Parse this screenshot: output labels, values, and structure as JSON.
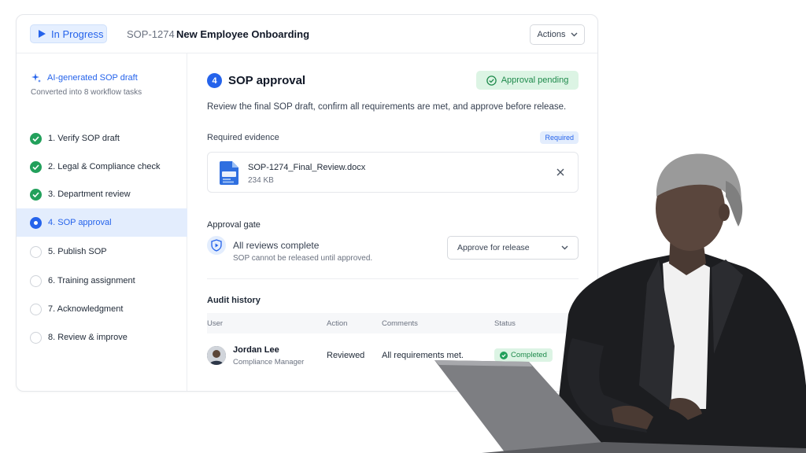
{
  "header": {
    "status": "In Progress",
    "sop_id": "SOP-1274",
    "title": "New Employee Onboarding",
    "actions_label": "Actions"
  },
  "sidebar": {
    "ai_title": "AI-generated SOP draft",
    "ai_subtitle": "Converted into 8 workflow tasks",
    "steps": [
      {
        "label": "1. Verify SOP draft",
        "state": "done"
      },
      {
        "label": "2. Legal & Compliance check",
        "state": "done"
      },
      {
        "label": "3. Department review",
        "state": "done"
      },
      {
        "label": "4. SOP approval",
        "state": "current"
      },
      {
        "label": "5. Publish SOP",
        "state": "todo"
      },
      {
        "label": "6. Training assignment",
        "state": "todo"
      },
      {
        "label": "7. Acknowledgment",
        "state": "todo"
      },
      {
        "label": "8. Review & improve",
        "state": "todo"
      }
    ]
  },
  "main": {
    "step_number": "4",
    "title": "SOP approval",
    "status_pill": "Approval pending",
    "description": "Review the final SOP draft, confirm all requirements are met, and approve before release.",
    "evidence": {
      "label": "Required evidence",
      "badge": "Required",
      "file_name": "SOP-1274_Final_Review.docx",
      "file_size": "234 KB"
    },
    "gate": {
      "label": "Approval gate",
      "title": "All reviews complete",
      "subtitle": "SOP cannot be released until approved.",
      "select_value": "Approve for release"
    },
    "audit": {
      "label": "Audit history",
      "columns": [
        "User",
        "Action",
        "Comments",
        "Status"
      ],
      "rows": [
        {
          "name": "Jordan Lee",
          "role": "Compliance Manager",
          "action": "Reviewed",
          "comment": "All requirements met.",
          "status": "Completed"
        }
      ]
    }
  },
  "colors": {
    "accent": "#2563eb",
    "success": "#22a05b",
    "success_bg": "#dcf4e4",
    "accent_bg": "#e3edfd"
  }
}
